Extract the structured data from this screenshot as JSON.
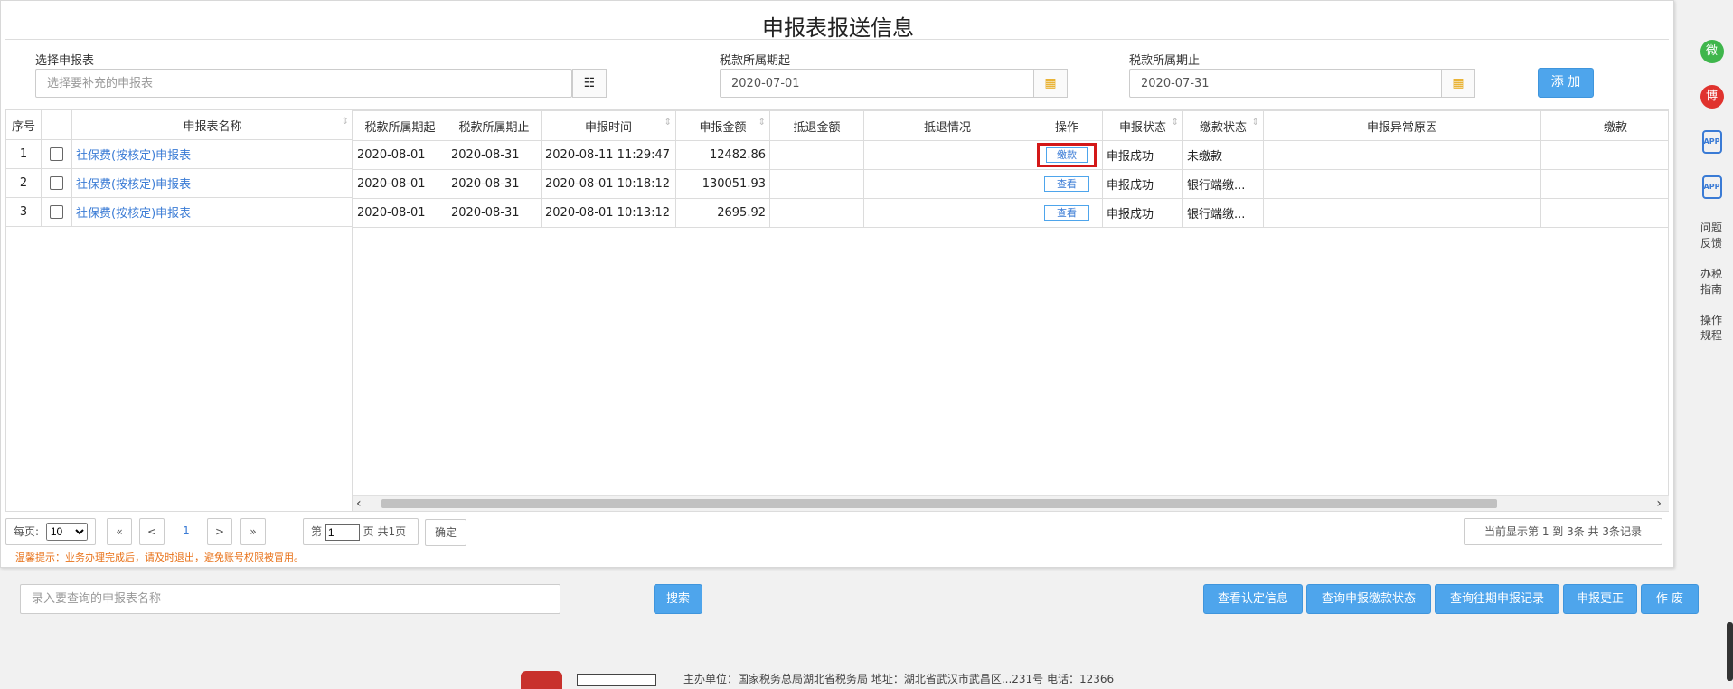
{
  "page_title": "申报表报送信息",
  "filters": {
    "report_label": "选择申报表",
    "report_placeholder": "选择要补充的申报表",
    "period_start_label": "税款所属期起",
    "period_start_value": "2020-07-01",
    "period_end_label": "税款所属期止",
    "period_end_value": "2020-07-31",
    "add_button": "添 加"
  },
  "table": {
    "headers": [
      "序号",
      "",
      "申报表名称",
      "税款所属期起",
      "税款所属期止",
      "申报时间",
      "申报金额",
      "抵退金额",
      "抵退情况",
      "操作",
      "申报状态",
      "缴款状态",
      "申报异常原因",
      "缴款"
    ],
    "rows": [
      {
        "no": "1",
        "name": "社保费(按核定)申报表",
        "start": "2020-08-01",
        "end": "2020-08-31",
        "time": "2020-08-11 11:29:47",
        "amount": "12482.86",
        "refund": "",
        "refund_status": "",
        "action": "缴款",
        "status": "申报成功",
        "pay_status": "未缴款",
        "reason": "",
        "extra": ""
      },
      {
        "no": "2",
        "name": "社保费(按核定)申报表",
        "start": "2020-08-01",
        "end": "2020-08-31",
        "time": "2020-08-01 10:18:12",
        "amount": "130051.93",
        "refund": "",
        "refund_status": "",
        "action": "查看",
        "status": "申报成功",
        "pay_status": "银行端缴...",
        "reason": "",
        "extra": ""
      },
      {
        "no": "3",
        "name": "社保费(按核定)申报表",
        "start": "2020-08-01",
        "end": "2020-08-31",
        "time": "2020-08-01 10:13:12",
        "amount": "2695.92",
        "refund": "",
        "refund_status": "",
        "action": "查看",
        "status": "申报成功",
        "pay_status": "银行端缴...",
        "reason": "",
        "extra": ""
      }
    ]
  },
  "pagination": {
    "per_page_label": "每页:",
    "per_page_value": "10",
    "first": "«",
    "prev": "<",
    "current": "1",
    "next": ">",
    "last": "»",
    "page_prefix": "第",
    "page_input": "1",
    "page_suffix": "页 共1页",
    "confirm": "确定",
    "summary": "当前显示第  1 到  3条 共  3条记录"
  },
  "tip": "温馨提示：业务办理完成后，请及时退出，避免账号权限被冒用。",
  "bottom": {
    "search_placeholder": "录入要查询的申报表名称",
    "search_button": "搜索",
    "buttons": [
      "查看认定信息",
      "查询申报缴款状态",
      "查询往期申报记录",
      "申报更正",
      "作 废"
    ]
  },
  "footer_text": "主办单位：国家税务总局湖北省税务局  地址：湖北省武汉市武昌区...231号  电话：12366",
  "sidebar": {
    "items": [
      "问题反馈",
      "办税指南",
      "操作规程"
    ],
    "wechat": "微",
    "weibo": "博",
    "app": "APP"
  },
  "colors": {
    "accent": "#4ea5ec",
    "link": "#3a7bd5",
    "highlight": "#d31818",
    "tip": "#e8731b"
  }
}
